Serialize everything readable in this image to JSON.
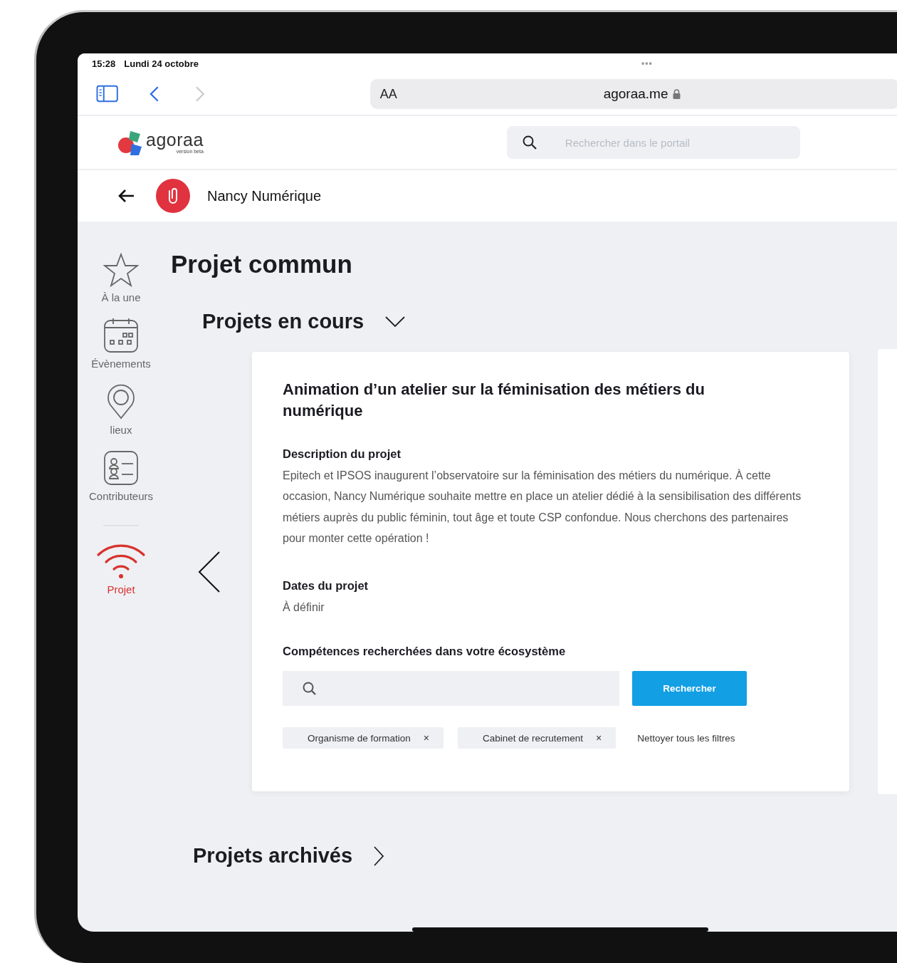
{
  "status_bar": {
    "time": "15:28",
    "date": "Lundi 24 octobre",
    "dots": "•••"
  },
  "browser": {
    "text_size": "AA",
    "url": "agoraa.me"
  },
  "header": {
    "logo": "agoraa",
    "logo_sub": "version beta",
    "search": {
      "placeholder": "Rechercher dans le portail"
    }
  },
  "org_bar": {
    "name": "Nancy Numérique"
  },
  "sidebar": {
    "items": [
      {
        "kind": "star",
        "label": "À la une",
        "selected": false
      },
      {
        "kind": "calendar",
        "label": "Évènements",
        "selected": false
      },
      {
        "kind": "pin",
        "label": "lieux",
        "selected": false
      },
      {
        "kind": "contacts",
        "label": "Contributeurs",
        "selected": false
      },
      {
        "kind": "signal",
        "label": "Projet",
        "selected": true
      }
    ]
  },
  "page_title": "Projet commun",
  "sections": [
    {
      "title": "Projets en cours",
      "expanded": true
    },
    {
      "title": "Projets archivés",
      "expanded": false
    }
  ],
  "card": {
    "title": "Animation d’un atelier sur la féminisation des métiers du numérique",
    "fields": [
      {
        "label": "Description du projet",
        "value": "Epitech et IPSOS inaugurent l’observatoire sur la féminisation des métiers du numérique. À cette occasion, Nancy Numérique souhaite mettre en place un atelier dédié à la sensibilisation des différents métiers auprès du public féminin, tout âge et toute CSP confondue. Nous cherchons des partenaires pour monter cette opération !"
      },
      {
        "label": "Dates du projet",
        "value": "À définir"
      }
    ],
    "skills_label": "Compétences recherchées dans votre écosystème",
    "search_button": "Rechercher",
    "filters": [
      {
        "label": "Organisme de formation",
        "remove": "×"
      },
      {
        "label": "Cabinet de recrutement",
        "remove": "×"
      }
    ],
    "clear_filters": "Nettoyer tous les filtres"
  }
}
